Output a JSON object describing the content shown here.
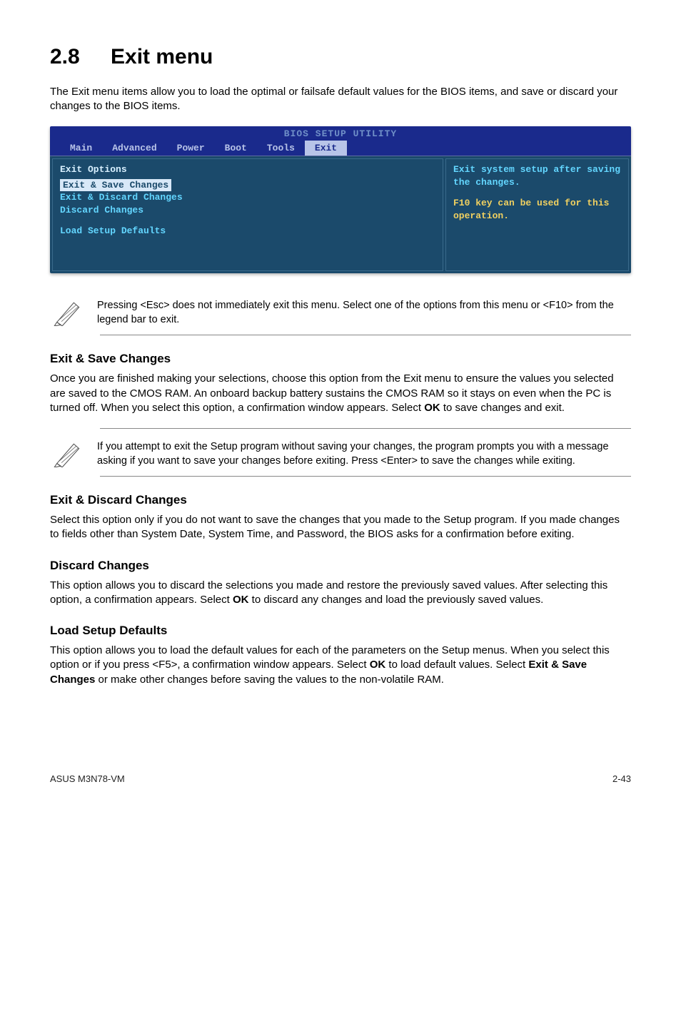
{
  "page": {
    "section_number": "2.8",
    "section_title": "Exit menu",
    "intro": "The Exit menu items allow you to load the optimal or failsafe default values for the BIOS items, and save or discard your changes to the BIOS items."
  },
  "bios": {
    "title": "BIOS SETUP UTILITY",
    "tabs": [
      "Main",
      "Advanced",
      "Power",
      "Boot",
      "Tools",
      "Exit"
    ],
    "left": {
      "heading": "Exit Options",
      "items": [
        "Exit & Save Changes",
        "Exit & Discard Changes",
        "Discard Changes",
        "Load Setup Defaults"
      ]
    },
    "right": {
      "line1": "Exit system setup after saving the changes.",
      "line2": "F10 key can be used for this operation."
    }
  },
  "note1": "Pressing <Esc> does not immediately exit this menu. Select one of the options from this menu or <F10> from the legend bar to exit.",
  "save": {
    "heading": "Exit & Save Changes",
    "body_pre": "Once you are finished making your selections, choose this option from the Exit menu to ensure the values you selected are saved to the CMOS RAM. An onboard backup battery sustains the CMOS RAM so it stays on even when the PC is turned off. When you select this option, a confirmation window appears. Select ",
    "body_bold": "OK",
    "body_post": " to save changes and exit."
  },
  "note2": " If you attempt to exit the Setup program without saving your changes, the program prompts you with a message asking if you want to save your changes before exiting. Press <Enter>  to save the  changes while exiting.",
  "discard_exit": {
    "heading": "Exit & Discard Changes",
    "body": "Select this option only if you do not want to save the changes that you  made to the Setup program. If you made changes to fields other than System Date, System Time, and Password, the BIOS asks for a confirmation before exiting."
  },
  "discard": {
    "heading": "Discard Changes",
    "body_pre": "This option allows you to discard the selections you made and restore the previously saved values. After selecting this option, a confirmation appears. Select ",
    "body_bold": "OK",
    "body_post": " to discard any changes and load the previously saved values."
  },
  "defaults": {
    "heading": "Load Setup Defaults",
    "body_pre": "This option allows you to load the default values for each of the parameters on the Setup menus. When you select this option or if you press <F5>, a confirmation window appears. Select ",
    "body_bold1": "OK",
    "body_mid": " to load default values. Select ",
    "body_bold2": "Exit & Save Changes",
    "body_post": " or make other changes before saving the values to the non-volatile RAM."
  },
  "footer": {
    "left": "ASUS M3N78-VM",
    "right": "2-43"
  }
}
